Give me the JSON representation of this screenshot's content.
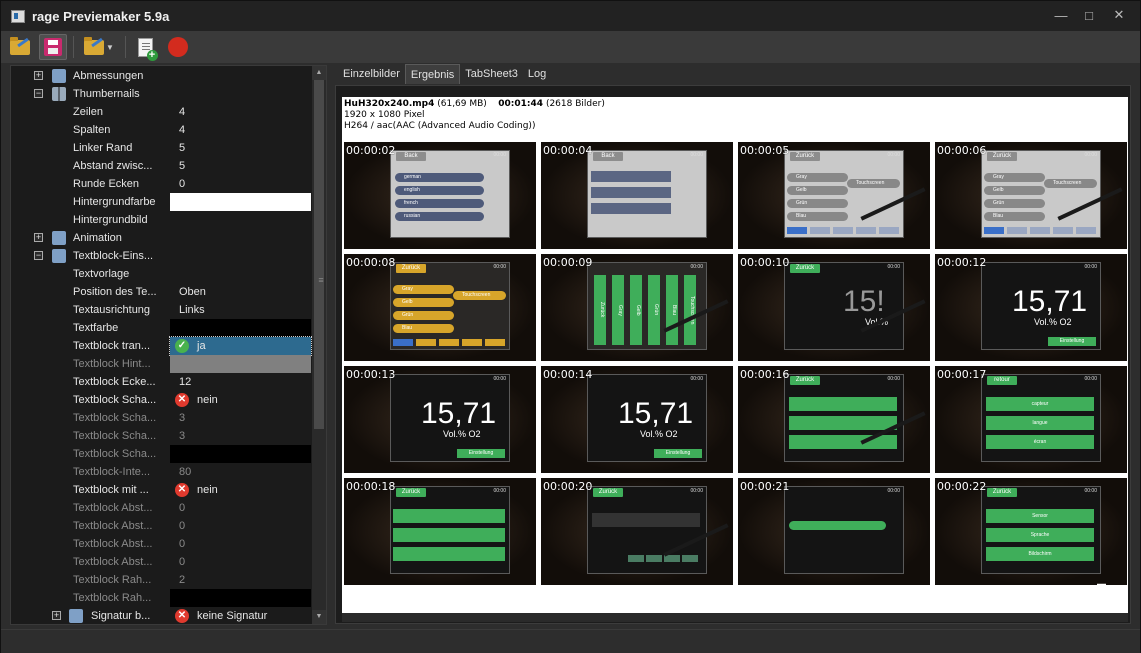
{
  "window": {
    "title": "rage Previemaker 5.9a",
    "controls": {
      "minimize": "—",
      "maximize": "□",
      "close": "✕"
    }
  },
  "toolbar": {
    "buttons": [
      {
        "name": "open-folder-button",
        "icon": "folder-open-icon"
      },
      {
        "name": "save-button",
        "icon": "floppy-icon"
      },
      {
        "name": "open-folder-dropdown-button",
        "icon": "folder-open-icon"
      },
      {
        "name": "new-document-button",
        "icon": "document-add-icon"
      },
      {
        "name": "record-button",
        "icon": "record-icon"
      }
    ]
  },
  "tree": {
    "rows": [
      {
        "label": "Abmessungen",
        "value": "",
        "type": "group-collapsed"
      },
      {
        "label": "Thumbernails",
        "value": "",
        "type": "group-expanded"
      },
      {
        "label": "Zeilen",
        "value": "4"
      },
      {
        "label": "Spalten",
        "value": "4"
      },
      {
        "label": "Linker Rand",
        "value": "5"
      },
      {
        "label": "Abstand zwisc...",
        "value": "5"
      },
      {
        "label": "Runde Ecken",
        "value": "0"
      },
      {
        "label": "Hintergrundfarbe",
        "value": "",
        "swatch": "#ffffff"
      },
      {
        "label": "Hintergrundbild",
        "value": ""
      },
      {
        "label": "Animation",
        "value": "",
        "type": "group-collapsed"
      },
      {
        "label": "Textblock-Eins...",
        "value": "",
        "type": "group-expanded"
      },
      {
        "label": "Textvorlage",
        "value": ""
      },
      {
        "label": "Position des Te...",
        "value": "Oben"
      },
      {
        "label": "Textausrichtung",
        "value": "Links"
      },
      {
        "label": "Textfarbe",
        "value": "",
        "swatch": "#000000"
      },
      {
        "label": "Textblock tran...",
        "value": "ja",
        "selected": true,
        "check": true
      },
      {
        "label": "Textblock Hint...",
        "value": "",
        "disabled": true,
        "swatch": "#808080"
      },
      {
        "label": "Textblock Ecke...",
        "value": "12"
      },
      {
        "label": "Textblock Scha...",
        "value": "nein",
        "cross": true
      },
      {
        "label": "Textblock Scha...",
        "value": "3",
        "disabled": true
      },
      {
        "label": "Textblock Scha...",
        "value": "3",
        "disabled": true
      },
      {
        "label": "Textblock Scha...",
        "value": "",
        "disabled": true,
        "swatch": "#000000"
      },
      {
        "label": "Textblock-Inte...",
        "value": "80",
        "disabled": true
      },
      {
        "label": "Textblock mit ...",
        "value": "nein",
        "cross": true
      },
      {
        "label": "Textblock Abst...",
        "value": "0",
        "disabled": true
      },
      {
        "label": "Textblock Abst...",
        "value": "0",
        "disabled": true
      },
      {
        "label": "Textblock Abst...",
        "value": "0",
        "disabled": true
      },
      {
        "label": "Textblock Abst...",
        "value": "0",
        "disabled": true
      },
      {
        "label": "Textblock Rah...",
        "value": "2",
        "disabled": true
      },
      {
        "label": "Textblock Rah...",
        "value": "",
        "disabled": true,
        "swatch": "#000000"
      },
      {
        "label": "Signatur b...",
        "value": "keine Signatur",
        "cross": true,
        "type": "group-collapsed-sub"
      }
    ]
  },
  "tabs": [
    "Einzelbilder",
    "Ergebnis",
    "TabSheet3",
    "Log"
  ],
  "active_tab": "Ergebnis",
  "result": {
    "file_name": "HuH320x240.mp4",
    "file_size": "(61,69 MB)",
    "duration": "00:01:44",
    "frames": "(2618 Bilder)",
    "resolution": "1920 x 1080 Pixel",
    "codec": "H264 / aac(AAC (Advanced Audio Coding))",
    "thumbnails": [
      {
        "time": "00:00:02",
        "kind": "menu-light",
        "tag": "Back",
        "items": [
          "german",
          "english",
          "french",
          "russian"
        ]
      },
      {
        "time": "00:00:04",
        "kind": "menu-light-bars",
        "tag": "Back",
        "items": [
          "",
          "",
          ""
        ]
      },
      {
        "time": "00:00:05",
        "kind": "color-light",
        "tag": "Zurück",
        "items": [
          "Gray",
          "Gelb",
          "Grün",
          "Blau"
        ],
        "extra": "Touchscreen"
      },
      {
        "time": "00:00:06",
        "kind": "color-light",
        "tag": "Zurück",
        "items": [
          "Gray",
          "Gelb",
          "Grün",
          "Blau"
        ],
        "extra": "Touchscreen"
      },
      {
        "time": "00:00:08",
        "kind": "color-dark",
        "tag": "Zurück",
        "items": [
          "Gray",
          "Gelb",
          "Grün",
          "Blau"
        ],
        "extra": "Touchscreen"
      },
      {
        "time": "00:00:09",
        "kind": "vertical-green",
        "tag": "",
        "items": [
          "Zurück",
          "Gray",
          "Gelb",
          "Grün",
          "Blau",
          "Touchscreen"
        ]
      },
      {
        "time": "00:00:10",
        "kind": "reading-partial",
        "tag": "Zurück",
        "value": "15!",
        "unit": "Vol.%"
      },
      {
        "time": "00:00:12",
        "kind": "reading",
        "tag": "",
        "value": "15,71",
        "unit": "Vol.% O2",
        "button": "Einstellung"
      },
      {
        "time": "00:00:13",
        "kind": "reading",
        "tag": "",
        "value": "15,71",
        "unit": "Vol.% O2",
        "button": "Einstellung"
      },
      {
        "time": "00:00:14",
        "kind": "reading",
        "tag": "",
        "value": "15,71",
        "unit": "Vol.% O2",
        "button": "Einstellung"
      },
      {
        "time": "00:00:16",
        "kind": "green-list",
        "tag": "Zurück",
        "items": [
          "",
          "",
          ""
        ]
      },
      {
        "time": "00:00:17",
        "kind": "green-list",
        "tag": "retour",
        "items": [
          "capteur",
          "langue",
          "écran"
        ]
      },
      {
        "time": "00:00:18",
        "kind": "green-list-wide",
        "tag": "Zurück",
        "items": [
          "",
          "",
          ""
        ]
      },
      {
        "time": "00:00:20",
        "kind": "dialog",
        "tag": "Zurück",
        "items": [
          "",
          "",
          ""
        ]
      },
      {
        "time": "00:00:21",
        "kind": "slider",
        "tag": "",
        "items": [
          "",
          ""
        ]
      },
      {
        "time": "00:00:22",
        "kind": "green-list",
        "tag": "Zurück",
        "items": [
          "Sensor",
          "Sprache",
          "Bildschirm"
        ]
      }
    ]
  },
  "colors": {
    "accent_green": "#3fae5a",
    "tag_yellow": "#d7a52a",
    "selection_blue": "#2d6a8f"
  }
}
